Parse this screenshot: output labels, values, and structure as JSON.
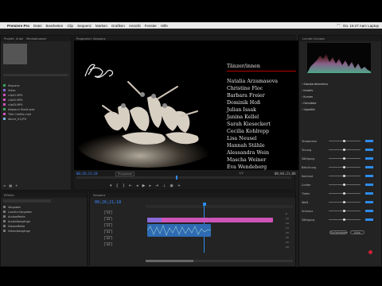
{
  "menu": {
    "app": "Premiere Pro",
    "items": [
      "Datei",
      "Bearbeiten",
      "Clip",
      "Sequenz",
      "Marken",
      "Grafiken",
      "Ansicht",
      "Fenster",
      "Hilfe"
    ],
    "right": "Do. 16:47   Aarc Laptop"
  },
  "project": {
    "tabs": [
      "Projekt: Unbe",
      "Mediabrowser"
    ],
    "items": [
      {
        "name": "Sequenz",
        "color": "#3aa55c"
      },
      {
        "name": "Video",
        "color": "#8a6ad8"
      },
      {
        "name": "clip01.MP4",
        "color": "#cf54b9"
      },
      {
        "name": "clip02.MP4",
        "color": "#cf54b9"
      },
      {
        "name": "clip03.MP4",
        "color": "#cf54b9"
      },
      {
        "name": "Abspann Musik.wav",
        "color": "#3aa55c"
      },
      {
        "name": "Titel Credits.mp4",
        "color": "#cf54b9"
      },
      {
        "name": "dance_01.JPG",
        "color": "#7bb6e6"
      }
    ]
  },
  "program": {
    "tab": "Programm: Sequenz",
    "timecode_left": "00;26;21;18",
    "fit": "Einpassen",
    "timecode_right": "00;04;21;08",
    "ratio": "1/2"
  },
  "video": {
    "logo": "Alizant",
    "credits_heading": "Tänzer/innen",
    "credits": [
      "Natalia Arzamasova",
      "Christine Floc",
      "Barbara Freier",
      "Dominik Hoß",
      "Julian Issak",
      "Janina Kellel",
      "Sarah Kieseckert",
      "Cecilia Kohlrepp",
      "Lisa Neusel",
      "Hannah Stähle",
      "Alessandra Wein",
      "Mascha Weiner",
      "Eva Wendeberg"
    ]
  },
  "lumetri": {
    "tab": "Lumetri-Scopes",
    "sections": [
      "Standardkorrektur",
      "Kreativ",
      "Kurven",
      "Farbräder",
      "Vignette"
    ],
    "rows": [
      "Temperatur",
      "Tonung",
      "Sättigung",
      "Belichtung",
      "Kontrast",
      "Lichter",
      "Tiefen",
      "Weiß",
      "Schwarz",
      "Sättigung"
    ],
    "reset": "Zurücksetzen",
    "auto": "Auto"
  },
  "effects": {
    "tab": "Effekte",
    "items": [
      "Vorgaben",
      "Lumetri-Vorgaben",
      "Audioeffekte",
      "Audioübergänge",
      "Videoeffekte",
      "Videoübergänge"
    ]
  },
  "timeline": {
    "tab": "Sequenz",
    "timecode": "00;26;21;18",
    "tracks": [
      "V3",
      "V2",
      "V1",
      "A1",
      "A2",
      "A3"
    ],
    "labels": [
      "Master"
    ]
  },
  "colors": {
    "accent": "#2d8ceb",
    "clip_pink": "#cf54b9",
    "clip_purple": "#8a6ad8",
    "audio_green": "#3aa55c"
  }
}
